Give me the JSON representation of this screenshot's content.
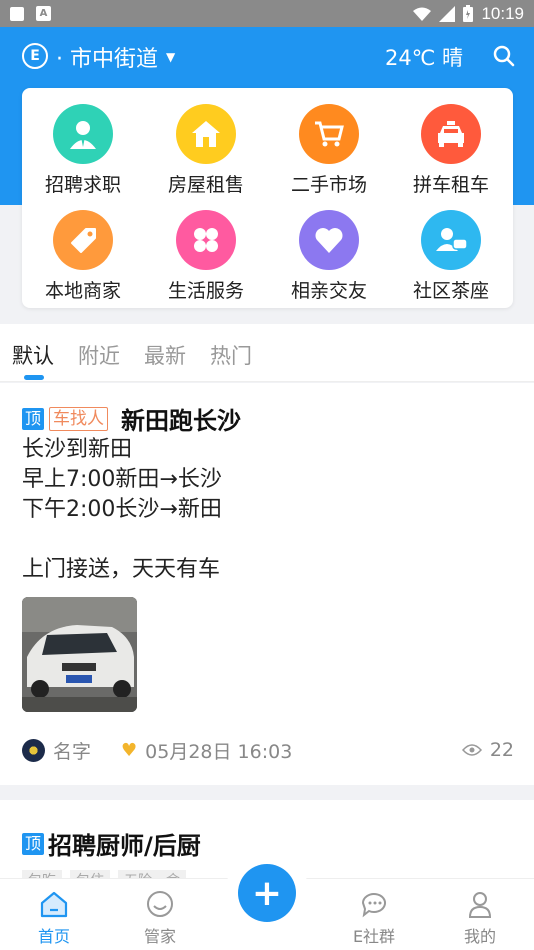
{
  "status_bar": {
    "time": "10:19"
  },
  "header": {
    "logo_letter": "E",
    "location": "· 市中街道",
    "weather": "24℃ 晴"
  },
  "categories": [
    {
      "label": "招聘求职",
      "icon": "job-icon",
      "color": "#2fd2b6"
    },
    {
      "label": "房屋租售",
      "icon": "house-icon",
      "color": "#ffcc1f"
    },
    {
      "label": "二手市场",
      "icon": "cart-icon",
      "color": "#ff8a1f"
    },
    {
      "label": "拼车租车",
      "icon": "taxi-icon",
      "color": "#ff5a3c"
    },
    {
      "label": "本地商家",
      "icon": "tag-icon",
      "color": "#ff9a3c"
    },
    {
      "label": "生活服务",
      "icon": "clover-icon",
      "color": "#ff5aa0"
    },
    {
      "label": "相亲交友",
      "icon": "heart-icon",
      "color": "#8c78f0"
    },
    {
      "label": "社区茶座",
      "icon": "chat-people-icon",
      "color": "#2eb8f0"
    }
  ],
  "tabs": [
    "默认",
    "附近",
    "最新",
    "热门"
  ],
  "post": {
    "badge_top": "顶",
    "badge_type": "车找人",
    "title": "新田跑长沙",
    "body": "长沙到新田\n早上7:00新田→长沙\n下午2:00长沙→新田\n\n上门接送，天天有车",
    "author": "名字",
    "date": "05月28日 16:03",
    "views": "22"
  },
  "post2": {
    "badge_top": "顶",
    "title": "招聘厨师/后厨",
    "tags": [
      "包吃",
      "包住",
      "五险一金"
    ]
  },
  "bottom_nav": {
    "home": "首页",
    "manager": "管家",
    "community": "E社群",
    "mine": "我的",
    "publish": "+"
  },
  "colors": {
    "primary": "#1f95f1",
    "accent": "#f08a5d"
  }
}
